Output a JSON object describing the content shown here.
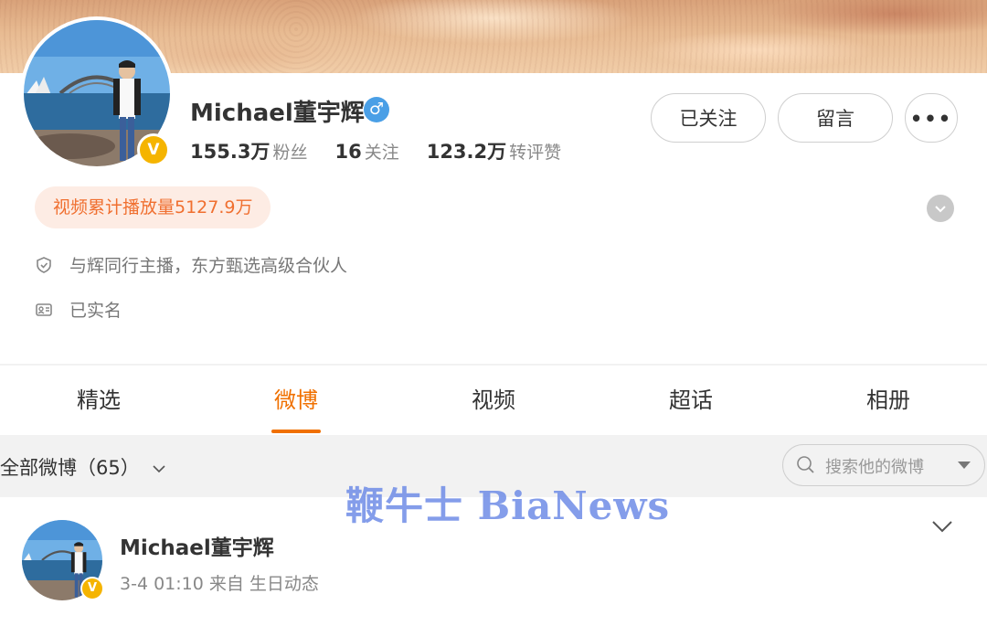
{
  "profile": {
    "name": "Michael董宇辉",
    "gender_symbol": "♂",
    "verified_badge": "V",
    "stats": [
      {
        "value": "155.3万",
        "label": "粉丝"
      },
      {
        "value": "16",
        "label": "关注"
      },
      {
        "value": "123.2万",
        "label": "转评赞"
      }
    ],
    "video_plays": "视频累计播放量5127.9万",
    "bio": "与辉同行主播，东方甄选高级合伙人",
    "real_name": "已实名"
  },
  "actions": {
    "follow_label": "已关注",
    "message_label": "留言",
    "more_label": "•••"
  },
  "tabs": [
    {
      "label": "精选"
    },
    {
      "label": "微博"
    },
    {
      "label": "视频"
    },
    {
      "label": "超话"
    },
    {
      "label": "相册"
    }
  ],
  "filter": {
    "label": "全部微博（65）",
    "search_placeholder": "搜索他的微博"
  },
  "post": {
    "author": "Michael董宇辉",
    "meta": "3-4 01:10  来自 生日动态"
  },
  "watermark": "鞭牛士 BiaNews",
  "colors": {
    "accent": "#f07000",
    "verified": "#f5b400",
    "gender": "#4a9fe6",
    "pill_text": "#f06f2f",
    "pill_bg": "#fdece4"
  },
  "icons": [
    "shield-check-icon",
    "id-card-icon",
    "chevron-down-icon",
    "search-icon",
    "caret-down-icon"
  ]
}
